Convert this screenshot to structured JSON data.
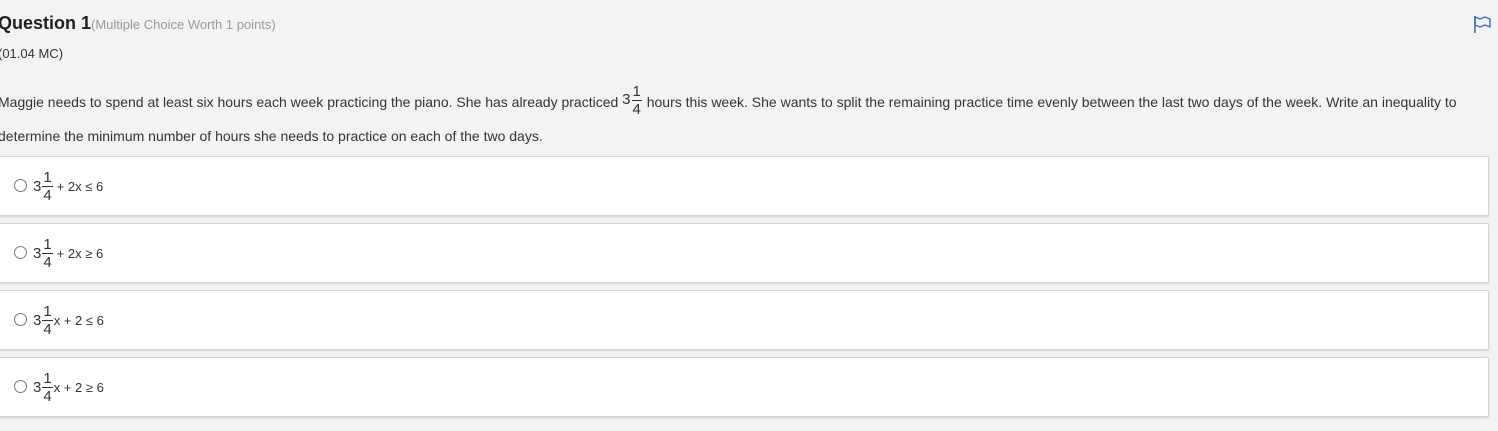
{
  "question": {
    "title": "Question 1",
    "worth": "(Multiple Choice Worth 1 points)",
    "code": "(01.04 MC)",
    "flag_icon": "flag-icon",
    "prompt_before": "Maggie needs to spend at least six hours each week practicing the piano. She has already practiced ",
    "prompt_mixed": {
      "whole": "3",
      "numerator": "1",
      "denominator": "4"
    },
    "prompt_after": " hours this week. She wants to split the remaining practice time evenly between the last two days of the week. Write an inequality to determine the minimum number of hours she needs to practice on each of the two days."
  },
  "choices": [
    {
      "whole": "3",
      "numerator": "1",
      "denominator": "4",
      "expression": "+ 2x ≤ 6",
      "selected": false
    },
    {
      "whole": "3",
      "numerator": "1",
      "denominator": "4",
      "expression": "+ 2x ≥ 6",
      "selected": false
    },
    {
      "whole": "3",
      "numerator": "1",
      "denominator": "4",
      "expression": "x + 2 ≤ 6",
      "selected": false
    },
    {
      "whole": "3",
      "numerator": "1",
      "denominator": "4",
      "expression": "x + 2 ≥ 6",
      "selected": false
    }
  ],
  "colors": {
    "background": "#f3f3f3",
    "card": "#ffffff",
    "flag": "#3b6fb6",
    "worth_text": "#999999"
  }
}
